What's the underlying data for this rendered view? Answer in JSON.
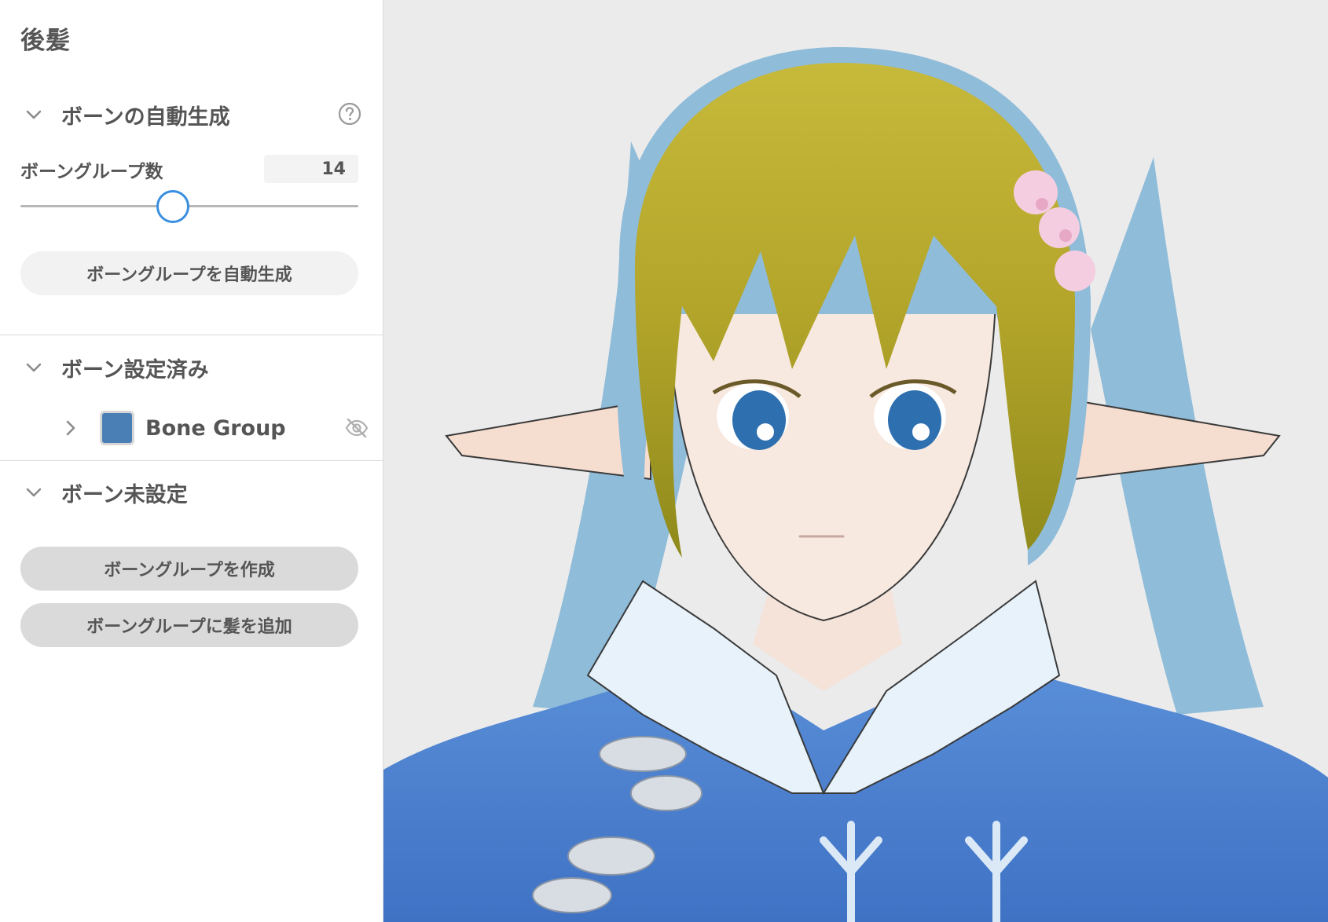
{
  "panel": {
    "title": "後髪"
  },
  "auto_generate": {
    "title": "ボーンの自動生成",
    "help_icon": "help-circle-icon",
    "count_label": "ボーングループ数",
    "count_value": "14",
    "slider_fraction": 0.45,
    "generate_button": "ボーングループを自動生成"
  },
  "configured": {
    "title": "ボーン設定済み",
    "groups": [
      {
        "name": "Bone Group",
        "color": "#4a7fb5",
        "visibility_icon": "eye-off-icon"
      }
    ]
  },
  "unconfigured": {
    "title": "ボーン未設定",
    "create_button": "ボーングループを作成",
    "add_hair_button": "ボーングループに髪を追加"
  },
  "colors": {
    "accent": "#3a8fe0",
    "text": "#555555",
    "viewport_bg": "#ebebeb"
  }
}
